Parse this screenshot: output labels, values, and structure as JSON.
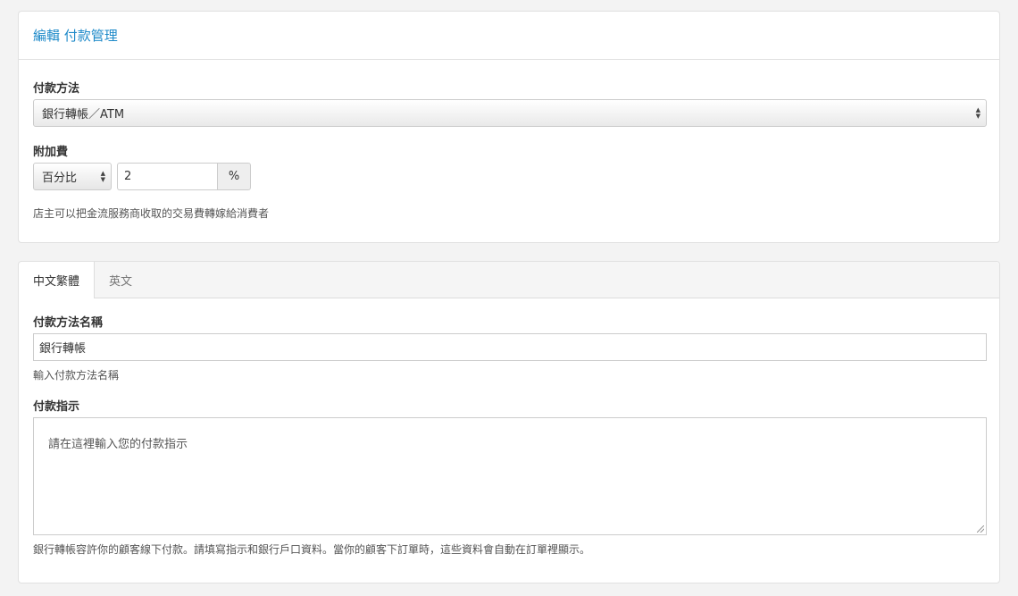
{
  "settings": {
    "title": "編輯 付款管理",
    "payment_method_label": "付款方法",
    "payment_method_value": "銀行轉帳／ATM",
    "surcharge_label": "附加費",
    "surcharge_type": "百分比",
    "surcharge_value": "2",
    "surcharge_unit": "%",
    "surcharge_help": "店主可以把金流服務商收取的交易費轉嫁給消費者"
  },
  "lang": {
    "tabs": [
      {
        "label": "中文繁體",
        "active": true
      },
      {
        "label": "英文",
        "active": false
      }
    ],
    "name_label": "付款方法名稱",
    "name_value": "銀行轉帳",
    "name_help": "輸入付款方法名稱",
    "instructions_label": "付款指示",
    "instructions_placeholder": "請在這裡輸入您的付款指示",
    "instructions_help": "銀行轉帳容許你的顧客線下付款。請填寫指示和銀行戶口資料。當你的顧客下訂單時，這些資料會自動在訂單裡顯示。"
  },
  "colors": {
    "accent": "#1f8ac9",
    "background": "#f3f3f3"
  }
}
